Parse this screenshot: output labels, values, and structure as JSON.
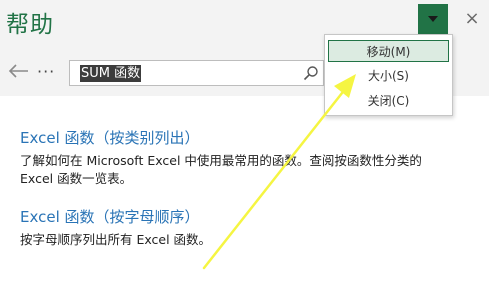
{
  "pane": {
    "title": "帮助",
    "task_pane_options_icon": "dropdown-triangle-icon",
    "close_label": "×",
    "accent_color": "#217346"
  },
  "nav": {
    "back_icon": "back-arrow-icon",
    "more_label": "···",
    "search_value": "SUM 函数",
    "search_icon": "search-icon"
  },
  "menu": {
    "items": [
      {
        "label": "移动(M)",
        "selected": true
      },
      {
        "label": "大小(S)",
        "selected": false
      },
      {
        "label": "关闭(C)",
        "selected": false
      }
    ]
  },
  "results": [
    {
      "title": "Excel 函数（按类别列出）",
      "lines": [
        "了解如何在 Microsoft Excel 中使用最常用的函数。查阅按函数性分类的",
        "Excel 函数一览表。"
      ]
    },
    {
      "title": "Excel 函数（按字母顺序）",
      "lines": [
        "按字母顺序列出所有 Excel 函数。"
      ]
    }
  ],
  "annotation": {
    "arrow_color": "#f5f542",
    "arrow_icon": "yellow-annotation-arrow"
  }
}
